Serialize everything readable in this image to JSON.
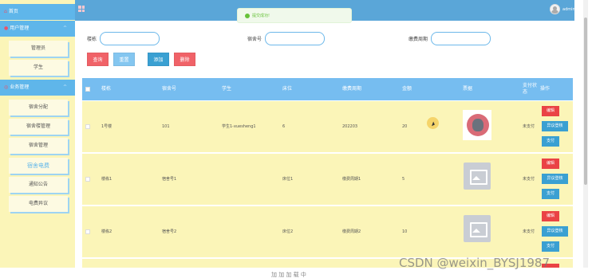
{
  "sidebar": {
    "home": "首页",
    "user_mgmt": "用户管理",
    "user_items": [
      "管理员",
      "学生"
    ],
    "biz_mgmt": "业务管理",
    "biz_items": [
      "宿舍分配",
      "宿舍楼管理",
      "宿舍管理",
      "宿舍电费",
      "通知公告",
      "电费异议"
    ]
  },
  "topbar": {
    "user": "admin"
  },
  "toast": {
    "message": "提交成功!"
  },
  "search": {
    "building_label": "楼栋",
    "room_label": "宿舍号",
    "period_label": "缴费周期",
    "query": "查询",
    "reset": "重置",
    "add": "添加",
    "delete": "删除"
  },
  "table": {
    "headers": [
      "楼栋",
      "宿舍号",
      "学生",
      "床位",
      "缴费周期",
      "金额",
      "票据",
      "支付状态",
      "操作"
    ],
    "rows": [
      {
        "building": "1号楼",
        "room": "101",
        "student": "学生1-xuesheng1",
        "bed": "6",
        "period": "202203",
        "amount": "20",
        "status": "未支付"
      },
      {
        "building": "楼栋1",
        "room": "宿舍号1",
        "student": "",
        "bed": "床位1",
        "period": "缴费周期1",
        "amount": "5",
        "status": "未支付"
      },
      {
        "building": "楼栋2",
        "room": "宿舍号2",
        "student": "",
        "bed": "床位2",
        "period": "缴费周期2",
        "amount": "10",
        "status": "未支付"
      }
    ],
    "actions": {
      "edit": "编辑",
      "dispute": "异议登核",
      "pay": "支付"
    }
  },
  "bottom_text": "加 加 加 载 中",
  "watermark": "CSDN @weixin_BYSJ1987",
  "colors": {
    "sidebar": "#fbf5b8",
    "topbar": "#5aa6d8",
    "header": "#76bdf0",
    "danger": "#ea4345",
    "primary": "#3aa0d2"
  }
}
